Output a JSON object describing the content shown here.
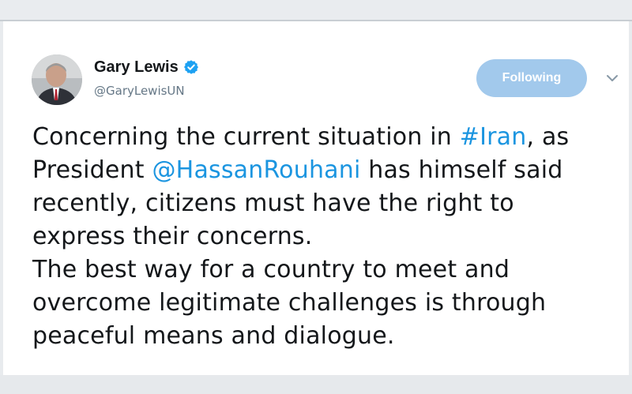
{
  "tweet": {
    "author": {
      "display_name": "Gary Lewis",
      "handle": "@GaryLewisUN",
      "verified": true,
      "avatar_icon": "profile-photo"
    },
    "follow_button_label": "Following",
    "menu_icon": "chevron-down-icon",
    "text_lines": [
      [
        {
          "text": "Concerning the current situation in ",
          "type": "text"
        },
        {
          "text": "#Iran",
          "type": "hashtag"
        },
        {
          "text": ", as",
          "type": "text"
        }
      ],
      [
        {
          "text": "President ",
          "type": "text"
        },
        {
          "text": "@HassanRouhani",
          "type": "mention"
        },
        {
          "text": " has himself said",
          "type": "text"
        }
      ],
      [
        {
          "text": "recently, citizens must have the right to",
          "type": "text"
        }
      ],
      [
        {
          "text": "express their concerns.",
          "type": "text"
        }
      ],
      [
        {
          "text": "The best way for a country to meet and",
          "type": "text"
        }
      ],
      [
        {
          "text": "overcome legitimate challenges is through",
          "type": "text"
        }
      ],
      [
        {
          "text": "peaceful means and dialogue.",
          "type": "text"
        }
      ]
    ]
  },
  "colors": {
    "link": "#1b95e0",
    "text": "#14171a",
    "secondary": "#657786",
    "follow_button_bg": "#a2c9ec",
    "verified": "#1da1f2"
  }
}
